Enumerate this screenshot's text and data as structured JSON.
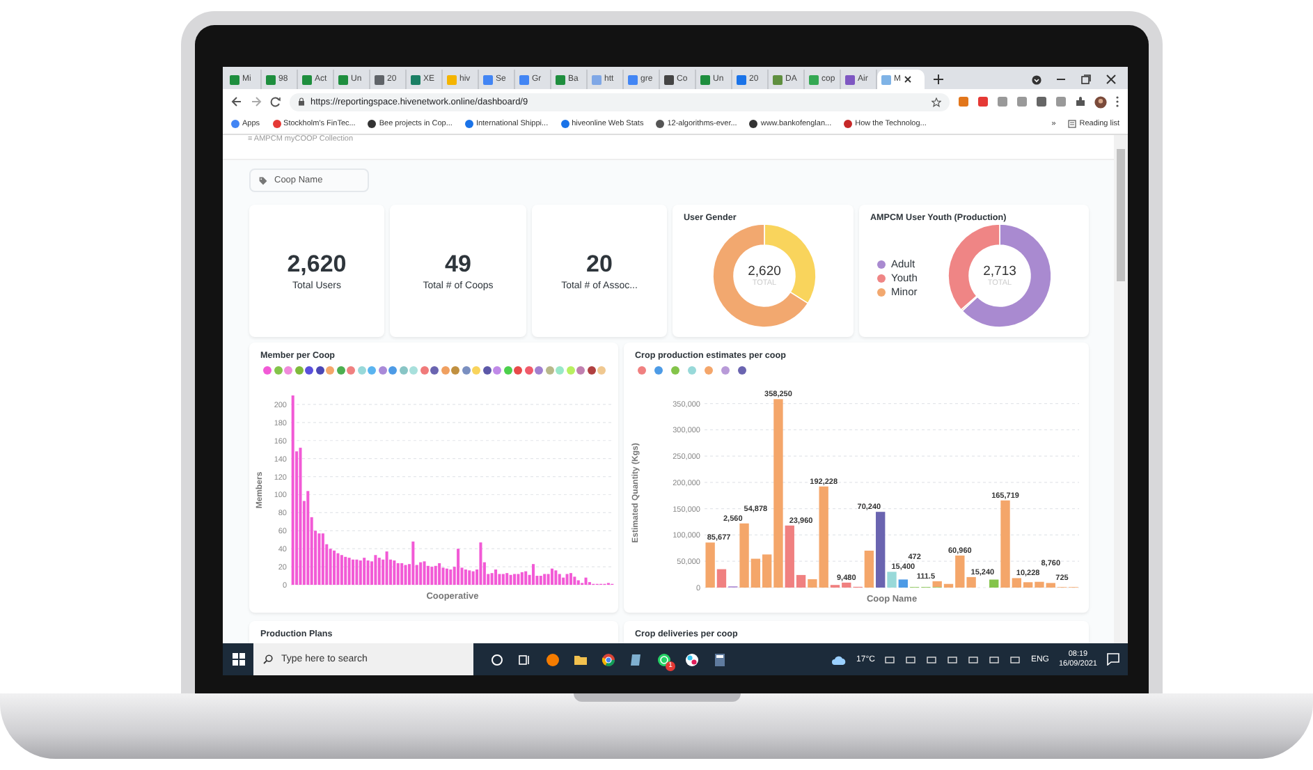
{
  "browser": {
    "tabs": [
      {
        "label": "Mi",
        "selected": false
      },
      {
        "label": "98",
        "selected": false
      },
      {
        "label": "Act",
        "selected": false
      },
      {
        "label": "Un",
        "selected": false
      },
      {
        "label": "20",
        "selected": false
      },
      {
        "label": "XE",
        "selected": false
      },
      {
        "label": "hiv",
        "selected": false
      },
      {
        "label": "Se",
        "selected": false
      },
      {
        "label": "Gr",
        "selected": false
      },
      {
        "label": "Ba",
        "selected": false
      },
      {
        "label": "htt",
        "selected": false
      },
      {
        "label": "gre",
        "selected": false
      },
      {
        "label": "Co",
        "selected": false
      },
      {
        "label": "Un",
        "selected": false
      },
      {
        "label": "20",
        "selected": false
      },
      {
        "label": "DA",
        "selected": false
      },
      {
        "label": "cop",
        "selected": false
      },
      {
        "label": "Air",
        "selected": false
      },
      {
        "label": "M",
        "selected": true
      }
    ],
    "url": "https://reportingspace.hivenetwork.online/dashboard/9",
    "bookmarks": [
      "Apps",
      "Stockholm's FinTec...",
      "Bee projects in Cop...",
      "International Shippi...",
      "hiveonline Web Stats",
      "12-algorithms-ever...",
      "www.bankofenglan...",
      "How the Technolog..."
    ],
    "more_bookmarks": "»",
    "reading_list": "Reading list"
  },
  "dashboard": {
    "collection": "≡ AMPCM myCOOP Collection",
    "filter": {
      "placeholder": "Coop Name"
    },
    "stats": [
      {
        "value": "2,620",
        "label": "Total Users"
      },
      {
        "value": "49",
        "label": "Total # of Coops"
      },
      {
        "value": "20",
        "label": "Total # of Assoc..."
      }
    ],
    "gender": {
      "title": "User Gender",
      "total": "2,620",
      "total_label": "TOTAL"
    },
    "youth": {
      "title": "AMPCM User Youth (Production)",
      "total": "2,713",
      "total_label": "TOTAL",
      "legend": [
        {
          "label": "Adult",
          "color": "#a98ad0"
        },
        {
          "label": "Youth",
          "color": "#ef8585"
        },
        {
          "label": "Minor",
          "color": "#f2a86f"
        }
      ]
    },
    "members": {
      "title": "Member per Coop",
      "legend": [
        {
          "color": "#f25ad6"
        },
        {
          "color": "#84c44a"
        },
        {
          "color": "#f08adb"
        },
        {
          "color": "#7fba3a"
        },
        {
          "color": "#5a4fdc"
        },
        {
          "color": "#4b47b5"
        },
        {
          "color": "#f4a66a"
        },
        {
          "color": "#4caf50"
        },
        {
          "color": "#f08080"
        },
        {
          "color": "#98d9d9"
        },
        {
          "color": "#5ab4f0"
        },
        {
          "color": "#a98ad8"
        },
        {
          "color": "#4d9be6"
        },
        {
          "color": "#88c5c5"
        },
        {
          "color": "#a8e0dc"
        },
        {
          "color": "#f07a7a"
        },
        {
          "color": "#6a64b0"
        },
        {
          "color": "#f0a060"
        },
        {
          "color": "#c09040"
        },
        {
          "color": "#7a8fc0"
        },
        {
          "color": "#f9d45c"
        },
        {
          "color": "#5c58a8"
        },
        {
          "color": "#c08ae8"
        },
        {
          "color": "#4cd04c"
        },
        {
          "color": "#e84a4a"
        },
        {
          "color": "#f05a6a"
        },
        {
          "color": "#a080d0"
        },
        {
          "color": "#b8b88a"
        },
        {
          "color": "#98e8c8"
        },
        {
          "color": "#b8f060"
        },
        {
          "color": "#c080b0"
        },
        {
          "color": "#b04040"
        },
        {
          "color": "#f0c890"
        }
      ],
      "chart_data": {
        "type": "bar",
        "grid": true,
        "xlabel": "Cooperative",
        "ylabel": "Members",
        "ylim": [
          0,
          210
        ],
        "yticks": [
          0,
          20,
          40,
          60,
          80,
          100,
          120,
          140,
          160,
          180,
          200
        ],
        "series": [
          {
            "color": "#f25ad6",
            "values": [
              210,
              148,
              152,
              93,
              104,
              75,
              60,
              57,
              57,
              45,
              40,
              38,
              35,
              33,
              31,
              30,
              28,
              28,
              27,
              30,
              27,
              26,
              33,
              30,
              28,
              37,
              28,
              27,
              24,
              24,
              22,
              23,
              48,
              22,
              25,
              26,
              21,
              20,
              21,
              24,
              19,
              18,
              17,
              20,
              40,
              19,
              17,
              16,
              15,
              17,
              47,
              25,
              12,
              13,
              17,
              12,
              12,
              13,
              11,
              12,
              12,
              14,
              15,
              11,
              23,
              10,
              10,
              12,
              12,
              18,
              16,
              12,
              8,
              12,
              13,
              9,
              5,
              2,
              8,
              3,
              1,
              1,
              1,
              1,
              2,
              1
            ]
          }
        ]
      }
    },
    "crops": {
      "title": "Crop production estimates per coop",
      "chart_data": {
        "type": "bar",
        "stacked": true,
        "grid": true,
        "xlabel": "Coop Name",
        "ylabel": "Estimated Quantity (Kgs)",
        "ylim": [
          0,
          360000
        ],
        "yticks": [
          {
            "value": 0,
            "label": "0"
          },
          {
            "value": 50000,
            "label": "50,000"
          },
          {
            "value": 100000,
            "label": "100,000"
          },
          {
            "value": 150000,
            "label": "150,000"
          },
          {
            "value": 200000,
            "label": "200,000"
          },
          {
            "value": 250000,
            "label": "250,000"
          },
          {
            "value": 300000,
            "label": "300,000"
          },
          {
            "value": 350000,
            "label": "350,000"
          }
        ],
        "series": [
          {
            "color": "#f08080",
            "values": [
              null,
              35000,
              null,
              null,
              null,
              null,
              null,
              118000,
              23960,
              null,
              null,
              5000,
              9480,
              1500,
              null,
              null,
              null,
              null,
              null,
              null,
              null,
              null,
              null,
              null,
              null,
              null,
              null,
              null,
              null,
              null,
              null,
              null,
              null
            ]
          },
          {
            "color": "#4d9be6",
            "values": [
              null,
              null,
              null,
              null,
              null,
              null,
              null,
              null,
              null,
              null,
              null,
              null,
              null,
              null,
              null,
              null,
              null,
              15400,
              null,
              null,
              null,
              null,
              null,
              null,
              null,
              null,
              null,
              null,
              null,
              null,
              null,
              null,
              null
            ]
          },
          {
            "color": "#84c44a",
            "values": [
              null,
              null,
              null,
              null,
              null,
              null,
              null,
              null,
              null,
              null,
              null,
              null,
              null,
              null,
              null,
              null,
              null,
              null,
              472,
              1115,
              1115,
              null,
              null,
              null,
              null,
              15240,
              null,
              null,
              null,
              null,
              null,
              null,
              null
            ]
          },
          {
            "color": "#98d9d9",
            "values": [
              null,
              null,
              null,
              null,
              null,
              null,
              null,
              null,
              null,
              null,
              null,
              null,
              null,
              null,
              null,
              null,
              30000,
              null,
              null,
              null,
              null,
              null,
              null,
              null,
              null,
              null,
              null,
              null,
              null,
              null,
              null,
              null,
              null
            ]
          },
          {
            "color": "#f4a66a",
            "values": [
              85677,
              null,
              null,
              122000,
              54878,
              63000,
              358250,
              null,
              null,
              16000,
              192228,
              null,
              null,
              null,
              70240,
              null,
              null,
              null,
              null,
              null,
              11000,
              7000,
              60960,
              20000,
              null,
              null,
              165719,
              18000,
              10228,
              11000,
              8760,
              725,
              500
            ]
          },
          {
            "color": "#b89ad8",
            "values": [
              null,
              null,
              2560,
              null,
              null,
              null,
              null,
              null,
              null,
              null,
              null,
              null,
              null,
              null,
              null,
              null,
              null,
              null,
              null,
              null,
              null,
              null,
              null,
              null,
              null,
              null,
              null,
              null,
              null,
              null,
              null,
              null,
              null
            ]
          },
          {
            "color": "#6a64b0",
            "values": [
              null,
              null,
              null,
              null,
              null,
              null,
              null,
              null,
              null,
              null,
              null,
              null,
              null,
              null,
              null,
              144000,
              null,
              null,
              null,
              null,
              null,
              null,
              null,
              null,
              null,
              null,
              null,
              null,
              null,
              null,
              null,
              null,
              null
            ]
          }
        ],
        "value_labels": [
          "85,677",
          null,
          "2,560",
          null,
          "54,878",
          null,
          "358,250",
          null,
          "23,960",
          null,
          "192,228",
          null,
          "9,480",
          null,
          "70,240",
          null,
          null,
          "15,400",
          "472",
          "111.5",
          null,
          null,
          "60,960",
          null,
          "15,240",
          null,
          "165,719",
          null,
          "10,228",
          null,
          "8,760",
          "725",
          null
        ]
      }
    },
    "bottom_cards": [
      "Production Plans",
      "Crop deliveries per coop"
    ]
  },
  "taskbar": {
    "search": {
      "placeholder": "Type here to search"
    },
    "chat_badge": "1",
    "temperature": "17°C",
    "language": "ENG",
    "time": "08:19",
    "date": "16/09/2021"
  }
}
